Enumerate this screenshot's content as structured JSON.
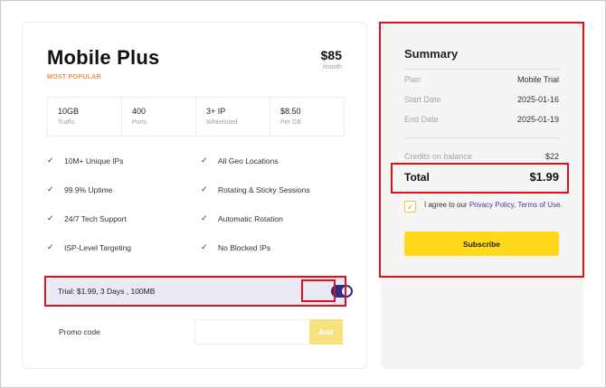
{
  "plan": {
    "name": "Mobile Plus",
    "badge": "MOST POPULAR",
    "price": "$85",
    "per": "/month",
    "stats": [
      {
        "value": "10GB",
        "label": "Traffic"
      },
      {
        "value": "400",
        "label": "Ports"
      },
      {
        "value": "3+ IP",
        "label": "Whitelisted"
      },
      {
        "value": "$8.50",
        "label": "Per GB"
      }
    ],
    "features": [
      "10M+ Unique IPs",
      "All Geo Locations",
      "99.9% Uptime",
      "Rotating & Sticky Sessions",
      "24/7 Tech Support",
      "Automatic Rotation",
      "ISP-Level Targeting",
      "No Blocked IPs"
    ],
    "trial_text": "Trial: $1.99, 3 Days , 100MB",
    "trial_enabled": true,
    "promo_label": "Promo code",
    "promo_value": "",
    "promo_placeholder": "",
    "promo_button": "Add"
  },
  "summary": {
    "title": "Summary",
    "rows": [
      {
        "key": "Plan",
        "value": "Mobile Trial"
      },
      {
        "key": "Start Date",
        "value": "2025-01-16"
      },
      {
        "key": "End Date",
        "value": "2025-01-19"
      }
    ],
    "credits_label": "Credits on balance",
    "credits_value": "$22",
    "total_label": "Total",
    "total_value": "$1.99",
    "agree_prefix": "I agree to our ",
    "privacy_link": "Privacy Policy",
    "agree_comma": ", ",
    "terms_link": "Terms of Use",
    "agree_suffix": ".",
    "agree_checked": true,
    "subscribe_label": "Subscribe"
  },
  "colors": {
    "accent_yellow": "#ffd91a",
    "toggle_on": "#2e2c8a",
    "badge_orange": "#e8914a",
    "highlight_red": "#e3101a",
    "link": "#3f3d9a"
  }
}
